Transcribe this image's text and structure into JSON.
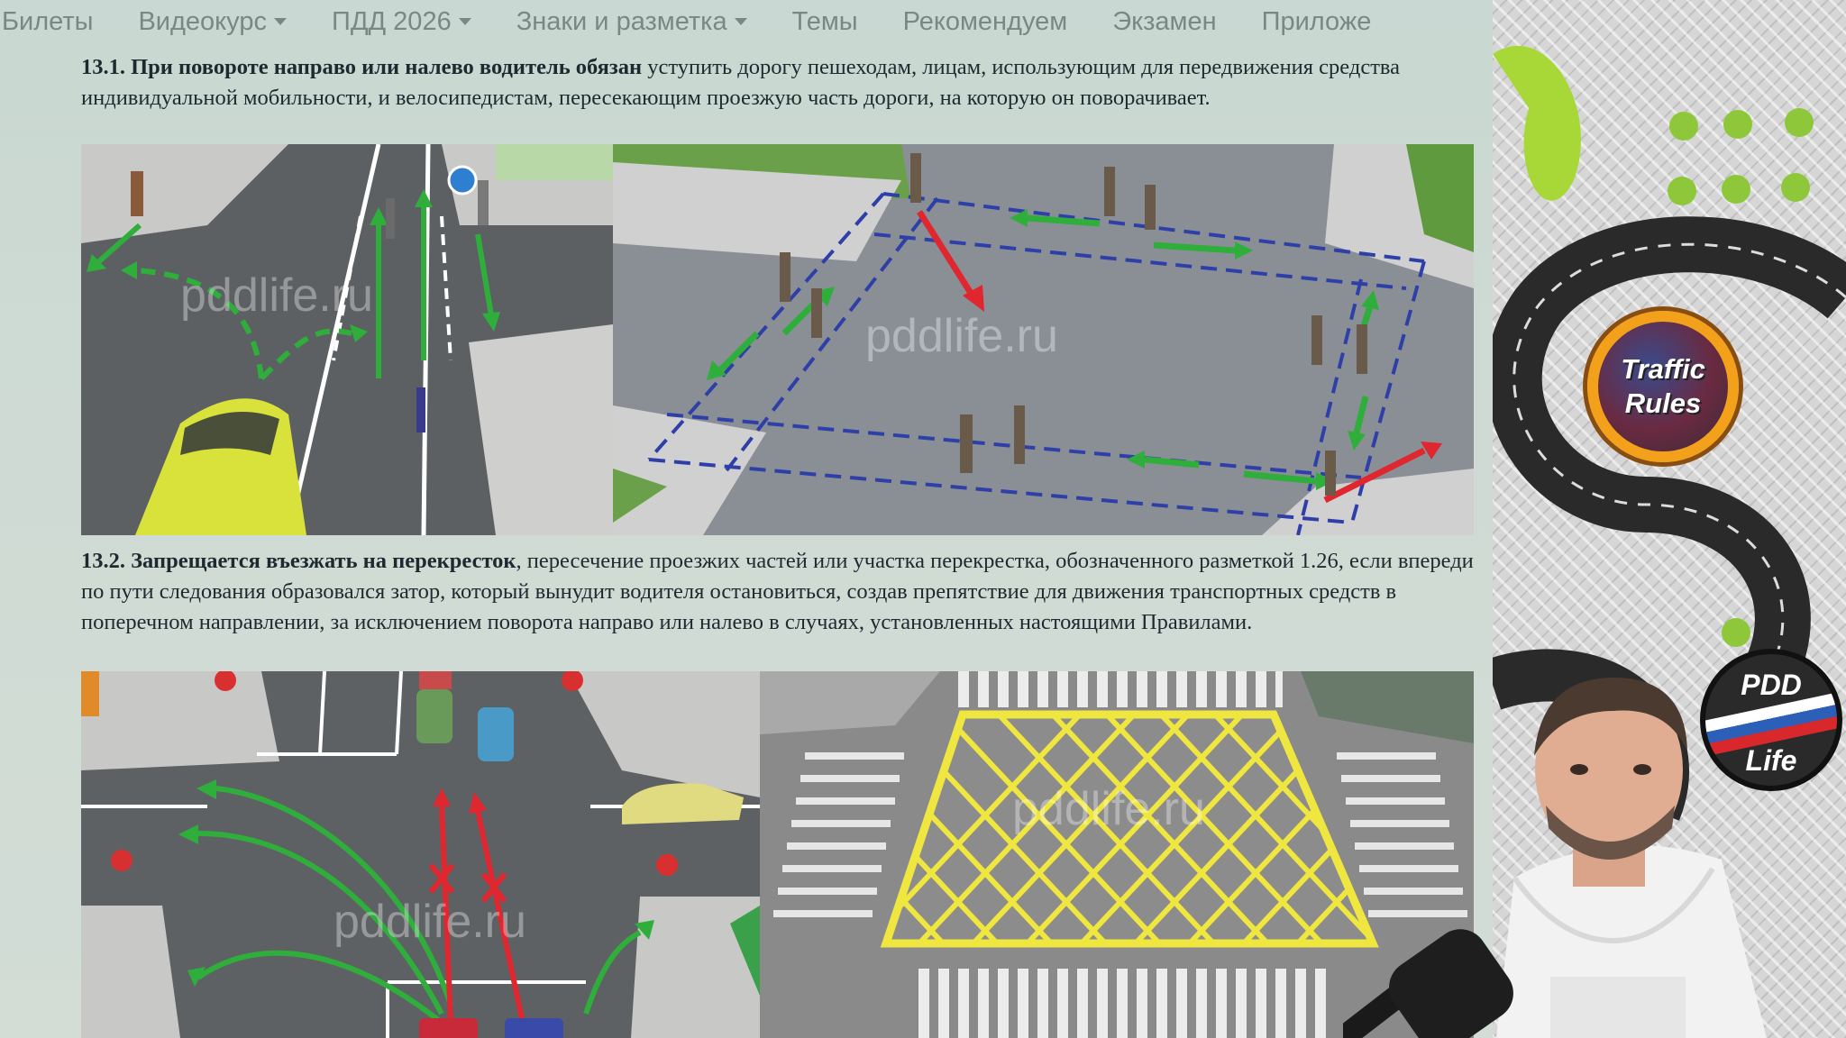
{
  "nav": {
    "items": [
      {
        "label": "Билеты",
        "dropdown": false
      },
      {
        "label": "Видеокурс",
        "dropdown": true
      },
      {
        "label": "ПДД 2026",
        "dropdown": true
      },
      {
        "label": "Знаки и разметка",
        "dropdown": true
      },
      {
        "label": "Темы",
        "dropdown": false
      },
      {
        "label": "Рекомендуем",
        "dropdown": false
      },
      {
        "label": "Экзамен",
        "dropdown": false
      },
      {
        "label": "Приложе",
        "dropdown": false
      }
    ]
  },
  "rules": {
    "r13_1": {
      "bold": "13.1. При повороте направо или налево водитель обязан",
      "text": " уступить дорогу пешеходам, лицам, использующим для передвижения средства индивидуальной мобильности, и велосипедистам, пересекающим проезжую часть дороги, на которую он поворачивает."
    },
    "r13_2": {
      "bold": "13.2. Запрещается въезжать на перекресток",
      "text": ", пересечение проезжих частей или участка перекрестка, обозначенного разметкой 1.26, если впереди по пути следования образовался затор, который вынудит водителя остановиться, создав препятствие для движения транспортных средств в поперечном направлении, за исключением поворота направо или налево в случаях, установленных настоящими Правилами."
    }
  },
  "illustrations": {
    "watermark": "pddlife.ru"
  },
  "side": {
    "badge_traffic_line1": "Traffic",
    "badge_traffic_line2": "Rules",
    "badge_pdd_line1": "PDD",
    "badge_pdd_line2": "Life"
  },
  "colors": {
    "arrow_green": "#2fae3c",
    "arrow_red": "#e0262e",
    "marking_yellow": "#f0e640",
    "dashed_blue": "#2f3fa8",
    "badge_orange": "#f3a01a"
  }
}
